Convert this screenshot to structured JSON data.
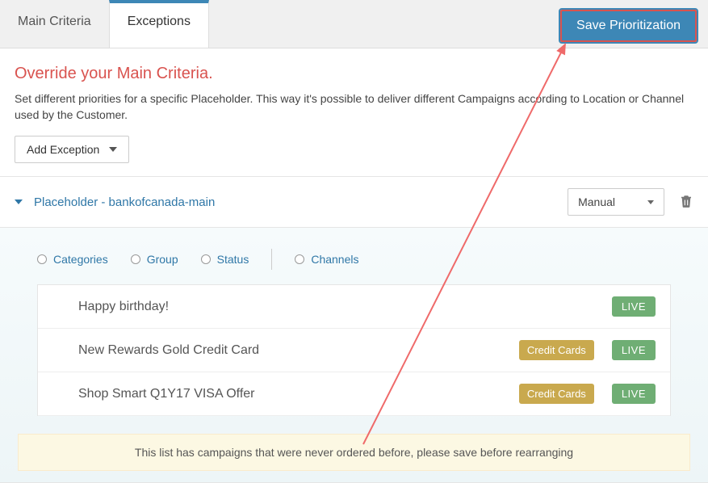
{
  "tabs": {
    "main": "Main Criteria",
    "exceptions": "Exceptions"
  },
  "save_label": "Save Prioritization",
  "override": {
    "title": "Override your Main Criteria.",
    "desc": "Set different priorities for a specific Placeholder. This way it's possible to deliver different Campaigns according to Location or Channel used by the Customer.",
    "add_label": "Add Exception"
  },
  "placeholder": {
    "name": "Placeholder - bankofcanada-main",
    "sort_mode": "Manual"
  },
  "filters": {
    "categories": "Categories",
    "group": "Group",
    "status": "Status",
    "channels": "Channels"
  },
  "campaigns": [
    {
      "title": "Happy birthday!",
      "tag": null,
      "status": "LIVE"
    },
    {
      "title": "New Rewards Gold Credit Card",
      "tag": "Credit Cards",
      "status": "LIVE"
    },
    {
      "title": "Shop Smart Q1Y17 VISA Offer",
      "tag": "Credit Cards",
      "status": "LIVE"
    }
  ],
  "notice": "This list has campaigns that were never ordered before, please save before rearranging"
}
